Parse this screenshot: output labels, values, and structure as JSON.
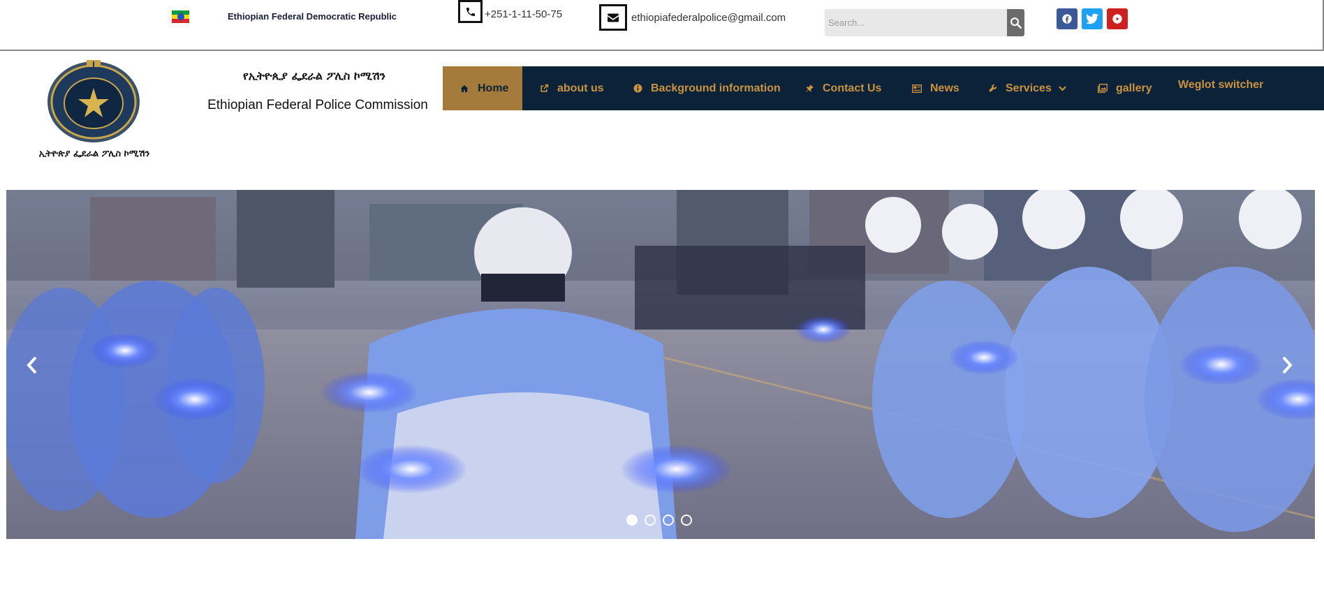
{
  "topbar": {
    "country": "Ethiopian Federal Democratic Republic",
    "phone": "+251-1-11-50-75",
    "email": "ethiopiafederalpolice@gmail.com",
    "search_placeholder": "Search...",
    "icons": {
      "phone": "phone-icon",
      "email": "envelope-icon",
      "search": "search-icon",
      "social": [
        "facebook-icon",
        "twitter-icon",
        "youtube-icon"
      ]
    }
  },
  "header": {
    "amharic_title": "የኢትዮጲያ ፌደራል ፖሊስ ኮሚሽን",
    "english_title": "Ethiopian Federal Police Commission",
    "logo_caption": "ኢትዮጵያ ፌደራል ፖሊስ ኮሚሽን"
  },
  "nav": {
    "items": [
      {
        "label": "Home",
        "icon": "home-icon"
      },
      {
        "label": "about us",
        "icon": "external-link-icon"
      },
      {
        "label": "Background information",
        "icon": "info-icon"
      },
      {
        "label": "Contact Us",
        "icon": "pin-icon"
      },
      {
        "label": "News",
        "icon": "newspaper-icon"
      },
      {
        "label": "Services",
        "icon": "wrench-icon"
      },
      {
        "label": "gallery",
        "icon": "image-icon"
      },
      {
        "label": "Weglot switcher",
        "icon": ""
      }
    ]
  },
  "slider": {
    "slide_count": 4,
    "active_slide": 1,
    "image_subject": "police motorcycle escort saluting"
  },
  "colors": {
    "nav_bg": "#0c2238",
    "nav_text": "#c9933f",
    "nav_active_bg": "#a47b3a",
    "facebook": "#3b5998",
    "twitter": "#1da1f2",
    "youtube": "#cd201f"
  }
}
